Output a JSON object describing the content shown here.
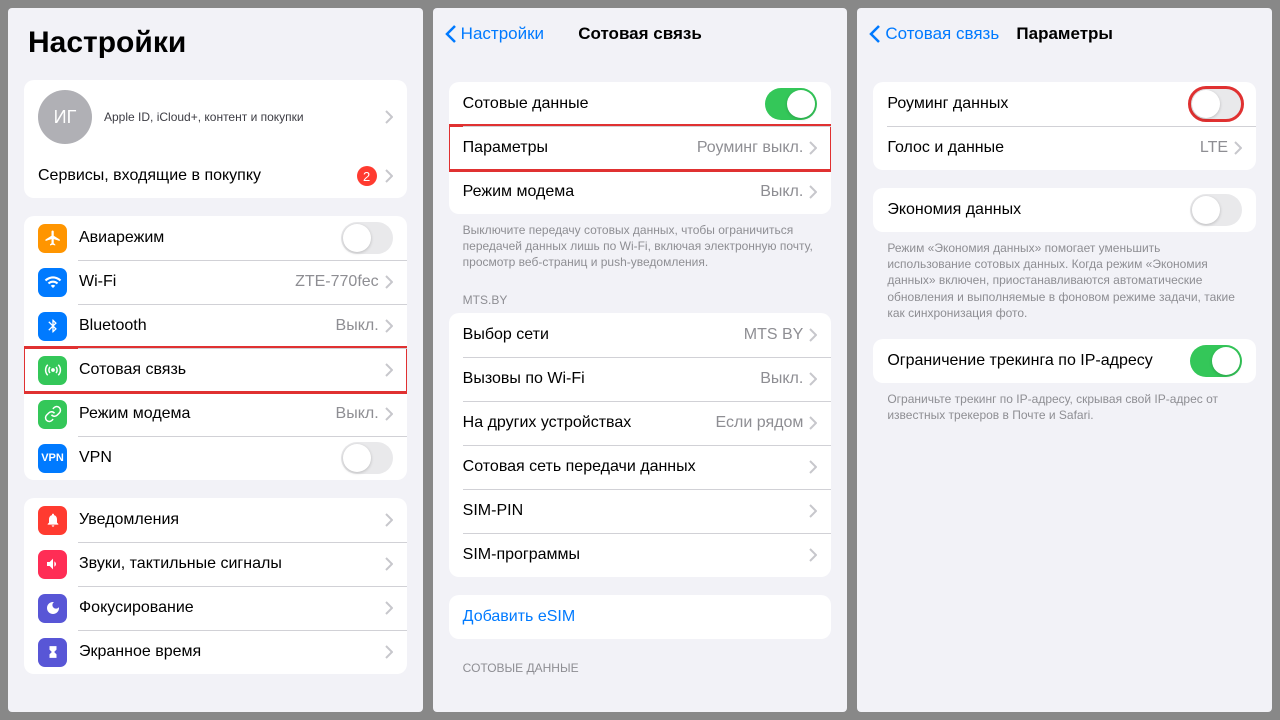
{
  "pane1": {
    "title": "Настройки",
    "appleId": {
      "initials": "ИГ",
      "subtitle": "Apple ID, iCloud+, контент и покупки"
    },
    "subscriptions_row": "Сервисы, входящие в покупку",
    "badge_count": "2",
    "items": [
      {
        "label": "Авиарежим",
        "detail": "",
        "type": "toggle",
        "state": "off",
        "iconColor": "#ff9500",
        "iconKind": "airplane"
      },
      {
        "label": "Wi-Fi",
        "detail": "ZTE-770fec",
        "type": "nav",
        "iconColor": "#007aff",
        "iconKind": "wifi"
      },
      {
        "label": "Bluetooth",
        "detail": "Выкл.",
        "type": "nav",
        "iconColor": "#007aff",
        "iconKind": "bluetooth"
      },
      {
        "label": "Сотовая связь",
        "detail": "",
        "type": "nav",
        "iconColor": "#34c759",
        "iconKind": "antenna",
        "highlight": true
      },
      {
        "label": "Режим модема",
        "detail": "Выкл.",
        "type": "nav",
        "iconColor": "#34c759",
        "iconKind": "link"
      },
      {
        "label": "VPN",
        "detail": "",
        "type": "toggle",
        "state": "off",
        "iconColor": "#007aff",
        "iconKind": "vpn"
      }
    ],
    "items2": [
      {
        "label": "Уведомления",
        "iconColor": "#ff3b30",
        "iconKind": "bell"
      },
      {
        "label": "Звуки, тактильные сигналы",
        "iconColor": "#ff2d55",
        "iconKind": "speaker"
      },
      {
        "label": "Фокусирование",
        "iconColor": "#5856d6",
        "iconKind": "moon"
      },
      {
        "label": "Экранное время",
        "iconColor": "#5856d6",
        "iconKind": "hourglass"
      }
    ]
  },
  "pane2": {
    "back": "Настройки",
    "title": "Сотовая связь",
    "rows1": [
      {
        "label": "Сотовые данные",
        "type": "toggle",
        "state": "on"
      },
      {
        "label": "Параметры",
        "detail": "Роуминг выкл.",
        "type": "nav",
        "highlight": true
      },
      {
        "label": "Режим модема",
        "detail": "Выкл.",
        "type": "nav"
      }
    ],
    "note1": "Выключите передачу сотовых данных, чтобы ограничиться передачей данных лишь по Wi-Fi, включая электронную почту, просмотр веб-страниц и push-уведомления.",
    "sectionHeader1": "MTS.BY",
    "rows2": [
      {
        "label": "Выбор сети",
        "detail": "MTS BY"
      },
      {
        "label": "Вызовы по Wi-Fi",
        "detail": "Выкл."
      },
      {
        "label": "На других устройствах",
        "detail": "Если рядом"
      },
      {
        "label": "Сотовая сеть передачи данных",
        "detail": ""
      },
      {
        "label": "SIM-PIN",
        "detail": ""
      },
      {
        "label": "SIM-программы",
        "detail": ""
      }
    ],
    "addEsim": "Добавить eSIM",
    "sectionHeader2": "СОТОВЫЕ ДАННЫЕ"
  },
  "pane3": {
    "back": "Сотовая связь",
    "title": "Параметры",
    "rows1": [
      {
        "label": "Роуминг данных",
        "type": "toggle",
        "state": "off",
        "highlight": true
      },
      {
        "label": "Голос и данные",
        "detail": "LTE",
        "type": "nav"
      }
    ],
    "rows2": [
      {
        "label": "Экономия данных",
        "type": "toggle",
        "state": "off"
      }
    ],
    "note2": "Режим «Экономия данных» помогает уменьшить использование сотовых данных. Когда режим «Экономия данных» включен, приостанавливаются автоматические обновления и выполняемые в фоновом режиме задачи, такие как синхронизация фото.",
    "rows3": [
      {
        "label": "Ограничение трекинга по IP-адресу",
        "type": "toggle",
        "state": "on"
      }
    ],
    "note3": "Ограничьте трекинг по IP-адресу, скрывая свой IP-адрес от известных трекеров в Почте и Safari."
  }
}
